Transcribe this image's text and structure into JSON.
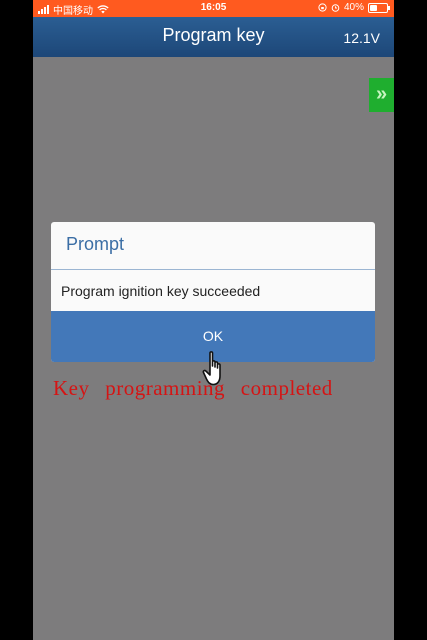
{
  "status_bar": {
    "carrier": "中国移动",
    "time": "16:05",
    "battery": "40%"
  },
  "header": {
    "title": "Program key",
    "voltage": "12.1V"
  },
  "side_tab": {
    "icon": "double-chevron-right-icon",
    "color": "#1fae2f"
  },
  "dialog": {
    "title": "Prompt",
    "message": "Program ignition key succeeded",
    "ok_label": "OK"
  },
  "annotation": "Key programming completed",
  "colors": {
    "status_bar": "#ff5a1f",
    "header": "#1d4778",
    "backdrop": "#7d7c7d",
    "ok_button": "#4378b9",
    "annotation": "#d51414"
  }
}
